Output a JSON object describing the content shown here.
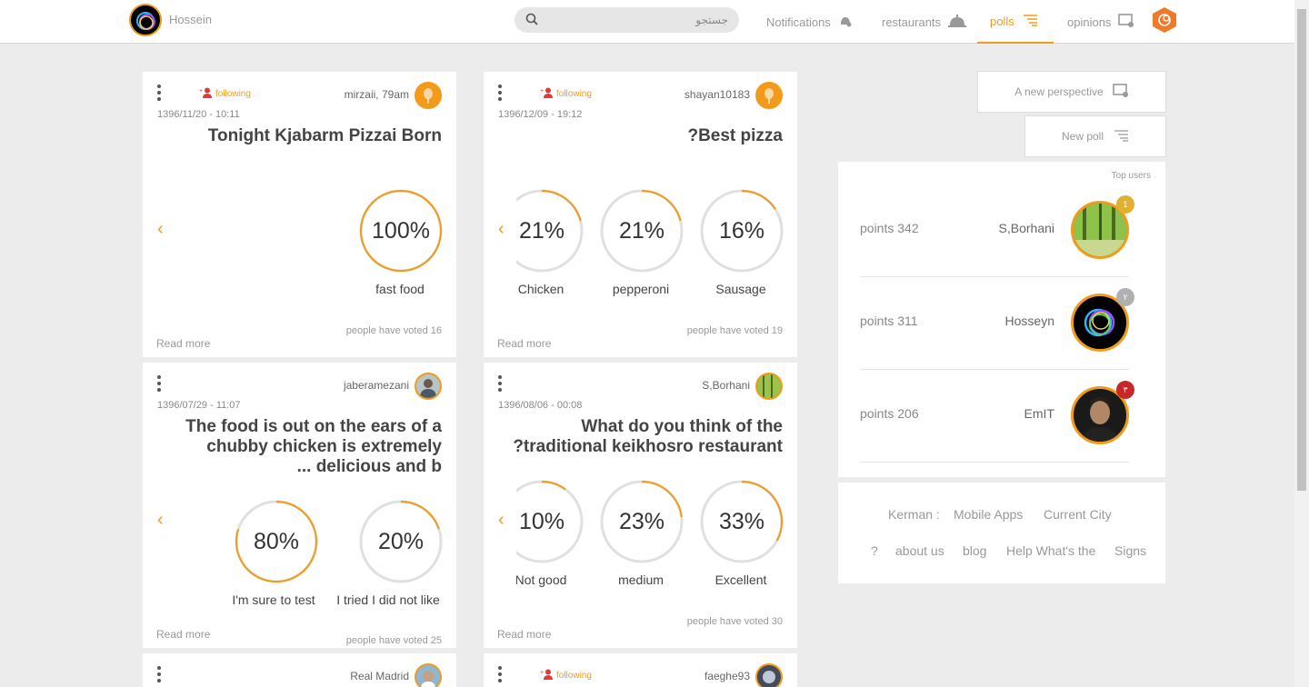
{
  "header": {
    "user_name": "Hossein",
    "search_placeholder": "جستجو",
    "nav": {
      "notifications": "Notifications",
      "restaurants": "restaurants",
      "polls": "polls",
      "opinions": "opinions"
    },
    "active_tab": "polls",
    "accent_color": "#f29b1a"
  },
  "cards": [
    {
      "author": "mirzaii, 79am",
      "following": "following",
      "date": "1396/11/20 - 10:11",
      "title": "Tonight Kjabarm Pizzai Born",
      "options": [
        {
          "label": "fast food",
          "pct": "100%",
          "value": 100
        }
      ],
      "votes": "people have voted 16",
      "read_more": "Read more"
    },
    {
      "author": "shayan10183",
      "following": "following",
      "date": "1396/12/09 - 19:12",
      "title": "?Best pizza",
      "options": [
        {
          "label": "Chicken",
          "pct": "21%",
          "value": 21
        },
        {
          "label": "pepperoni",
          "pct": "21%",
          "value": 21
        },
        {
          "label": "Sausage",
          "pct": "16%",
          "value": 16
        }
      ],
      "votes": "people have voted 19",
      "read_more": "Read more"
    },
    {
      "author": "jaberamezani",
      "date": "1396/07/29 - 11:07",
      "title_lines": [
        "The food is out on the ears of a",
        "chubby chicken is extremely",
        "... delicious and b"
      ],
      "options": [
        {
          "label": "I'm sure to test",
          "pct": "80%",
          "value": 80
        },
        {
          "label": "I tried I did not like",
          "pct": "20%",
          "value": 20
        }
      ],
      "votes": "people have voted 25",
      "read_more": "Read more"
    },
    {
      "author": "S,Borhani",
      "date": "1396/08/06 - 00:08",
      "title_lines": [
        "What do you think of the",
        "?traditional keikhosro restaurant"
      ],
      "options": [
        {
          "label": "Not good",
          "pct": "10%",
          "value": 10
        },
        {
          "label": "medium",
          "pct": "23%",
          "value": 23
        },
        {
          "label": "Excellent",
          "pct": "33%",
          "value": 33
        }
      ],
      "votes": "people have voted 30",
      "read_more": "Read more"
    },
    {
      "author": "Real Madrid"
    },
    {
      "author": "faeghe93",
      "following": "following"
    }
  ],
  "sidebar": {
    "new_perspective": "A new perspective",
    "new_poll": "New poll",
    "top_users_title": "Top users",
    "top_users": [
      {
        "name": "S,Borhani",
        "points": "points 342",
        "medal": "1"
      },
      {
        "name": "Hosseyn",
        "points": "points 311",
        "medal": "۲"
      },
      {
        "name": "EmIT",
        "points": "points 206",
        "medal": "۳"
      }
    ],
    "footer": {
      "city_label": "Kerman :",
      "mobile_apps": "Mobile Apps",
      "current_city": "Current City",
      "q": "?",
      "about": "about us",
      "blog": "blog",
      "help": "Help What's the",
      "signs": "Signs"
    }
  }
}
